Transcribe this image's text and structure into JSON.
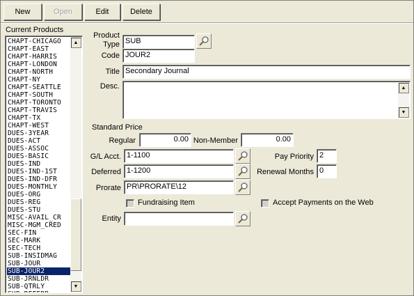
{
  "toolbar": {
    "new_label": "New",
    "open_label": "Open",
    "edit_label": "Edit",
    "delete_label": "Delete"
  },
  "products": {
    "title": "Current Products",
    "items": [
      "CHAPT-CHICAGO",
      "CHAPT-EAST",
      "CHAPT-HARRIS",
      "CHAPT-LONDON",
      "CHAPT-NORTH",
      "CHAPT-NY",
      "CHAPT-SEATTLE",
      "CHAPT-SOUTH",
      "CHAPT-TORONTO",
      "CHAPT-TRAVIS",
      "CHAPT-TX",
      "CHAPT-WEST",
      "DUES-3YEAR",
      "DUES-ACT",
      "DUES-ASSOC",
      "DUES-BASIC",
      "DUES-IND",
      "DUES-IND-1ST",
      "DUES-IND-DFR",
      "DUES-MONTHLY",
      "DUES-ORG",
      "DUES-REG",
      "DUES-STU",
      "MISC-AVAIL_CR",
      "MISC-MGM_CRED",
      "SEC-FIN",
      "SEC-MARK",
      "SEC-TECH",
      "SUB-INSIDMAG",
      "SUB-JOUR",
      "SUB-JOUR2",
      "SUB-JRNLDR",
      "SUB-QTRLY",
      "SUB-REFERR..."
    ],
    "selected_index": 30
  },
  "form": {
    "product_type_label_1": "Product",
    "product_type_label_2": "Type",
    "product_type_value": "SUB",
    "code_label": "Code",
    "code_value": "JOUR2",
    "title_label": "Title",
    "title_value": "Secondary Journal",
    "desc_label": "Desc.",
    "desc_value": "",
    "standard_price_label": "Standard Price",
    "regular_label": "Regular",
    "regular_value": "0.00",
    "non_member_label": "Non-Member",
    "non_member_value": "0.00",
    "gl_acct_label": "G/L Acct.",
    "gl_acct_value": "1-1100",
    "pay_priority_label": "Pay Priority",
    "pay_priority_value": "2",
    "deferred_label": "Deferred",
    "deferred_value": "1-1200",
    "renewal_months_label": "Renewal Months",
    "renewal_months_value": "0",
    "prorate_label": "Prorate",
    "prorate_value": "PR\\PRORATE\\12",
    "fundraising_label": "Fundraising Item",
    "fundraising_checked": false,
    "accept_web_label": "Accept Payments on the Web",
    "accept_web_checked": false,
    "entity_label": "Entity",
    "entity_value": ""
  },
  "colors": {
    "window_bg": "#ece9d8",
    "selection_bg": "#0a246a",
    "selection_fg": "#ffffff"
  }
}
